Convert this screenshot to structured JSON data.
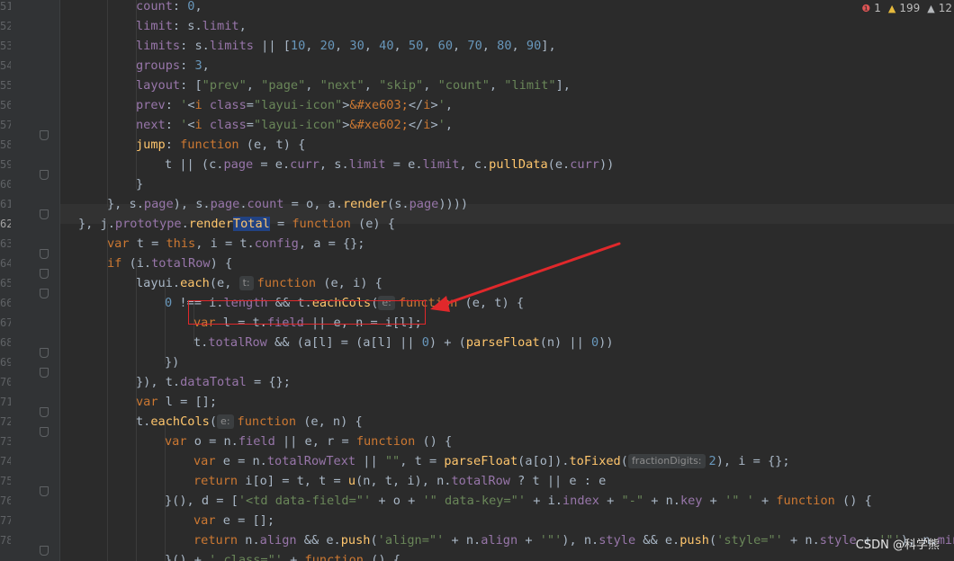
{
  "inspections": {
    "errors": "1",
    "warnings": "199",
    "weak_warnings": "12"
  },
  "line_numbers": [
    "51",
    "52",
    "53",
    "54",
    "55",
    "56",
    "57",
    "58",
    "59",
    "60",
    "61",
    "62",
    "63",
    "64",
    "65",
    "66",
    "67",
    "68",
    "69",
    "70",
    "71",
    "72",
    "73",
    "74",
    "75",
    "76",
    "77",
    "78"
  ],
  "hints": {
    "t": "t:",
    "e1": "e:",
    "e2": "e:",
    "fraction_digits": "fractionDigits:"
  },
  "watermark": "CSDN @科学熊",
  "colors": {
    "background": "#2b2b2b",
    "keyword": "#cc7832",
    "string": "#6a8759",
    "number": "#6897bb",
    "function": "#ffc66d",
    "property": "#9876aa",
    "annotation": "#e0282b"
  },
  "code_lines": [
    "count: 0,",
    "limit: s.limit,",
    "limits: s.limits || [10, 20, 30, 40, 50, 60, 70, 80, 90],",
    "groups: 3,",
    "layout: [\"prev\", \"page\", \"next\", \"skip\", \"count\", \"limit\"],",
    "prev: '<i class=\"layui-icon\">&#xe603;</i>',",
    "next: '<i class=\"layui-icon\">&#xe602;</i>',",
    "jump: function (e, t) {",
    "t || (c.page = e.curr, s.limit = e.limit, c.pullData(e.curr))",
    "}",
    "}, s.page), s.page.count = o, a.render(s.page))))",
    "}, j.prototype.renderTotal = function (e) {",
    "var t = this, i = t.config, a = {};",
    "if (i.totalRow) {",
    "layui.each(e, function (e, i) {",
    "0 !== i.length && t.eachCols(function (e, t) {",
    "var l = t.field || e, n = i[l];",
    "t.totalRow && (a[l] = (a[l] || 0) + (parseFloat(n) || 0))",
    "})",
    "}), t.dataTotal = {};",
    "var l = [];",
    "t.eachCols(function (e, n) {",
    "var o = n.field || e, r = function () {",
    "var e = n.totalRowText || \"\", t = parseFloat(a[o]).toFixed(2), i = {};",
    "return i[o] = t, t = u(n, t, i), n.totalRow ? t || e : e",
    "}(), d = ['<td data-field=\"' + o + '\" data-key=\"' + i.index + \"-\" + n.key + '\" ' + function () {",
    "var e = [];",
    "return n.align && e.push('align=\"' + n.align + '\"'), n.style && e.push('style=\"' + n.style + '\"'), n.minWi",
    "}() + ' class=\"' + function () {"
  ]
}
